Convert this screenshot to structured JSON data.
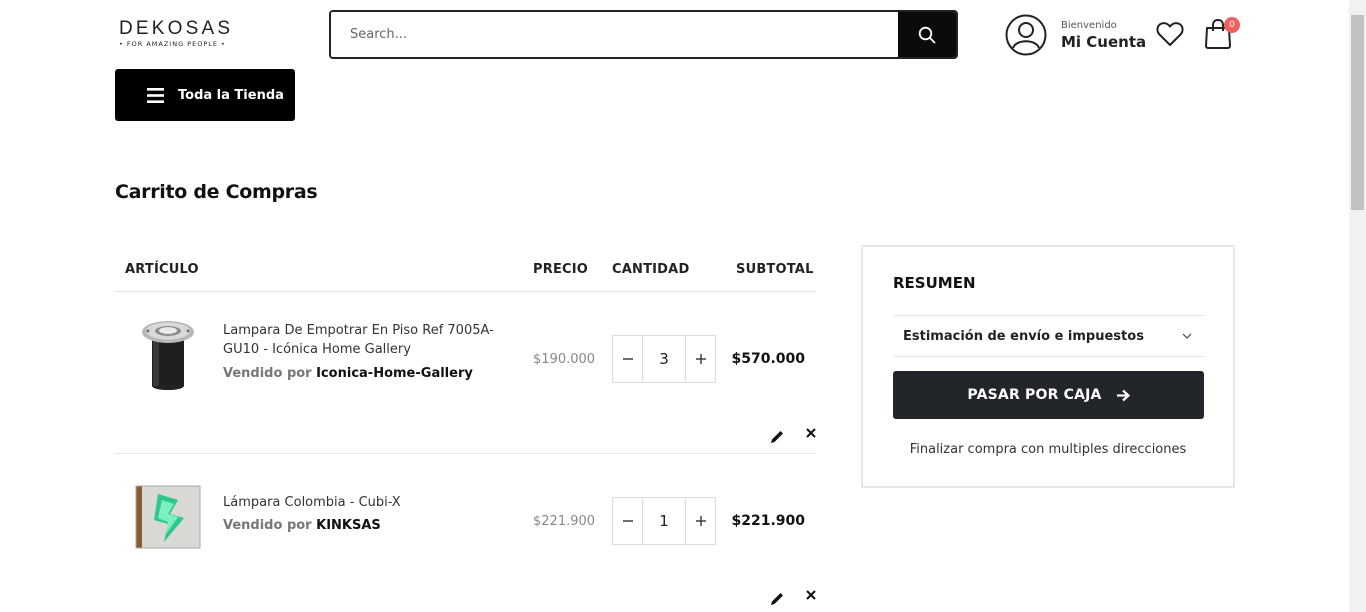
{
  "header": {
    "logo_main": "DEKOSAS",
    "logo_sub": "• FOR AMAZING PEOPLE •",
    "search_placeholder": "Search...",
    "account_greeting": "Bienvenido",
    "account_label": "Mi Cuenta",
    "cart_count": "0",
    "store_button": "Toda la Tienda"
  },
  "page_title": "Carrito de Compras",
  "table_headers": {
    "item": "ARTÍCULO",
    "price": "PRECIO",
    "quantity": "CANTIDAD",
    "subtotal": "SUBTOTAL"
  },
  "items": [
    {
      "name": "Lampara De Empotrar En Piso Ref 7005A-GU10 - Icónica Home Gallery",
      "sold_by_label": "Vendido por",
      "vendor": "Iconica-Home-Gallery",
      "price": "$190.000",
      "qty": "3",
      "subtotal": "$570.000"
    },
    {
      "name": "Lámpara Colombia - Cubi-X",
      "sold_by_label": "Vendido por",
      "vendor": "KINKSAS",
      "price": "$221.900",
      "qty": "1",
      "subtotal": "$221.900"
    }
  ],
  "summary": {
    "title": "RESUMEN",
    "shipping": "Estimación de envío e impuestos",
    "checkout": "PASAR POR CAJA",
    "multi": "Finalizar compra con multiples direcciones"
  },
  "colors": {
    "primary_button": "#222529",
    "badge": "#f15e5e",
    "search_button": "#0b0b0b"
  }
}
